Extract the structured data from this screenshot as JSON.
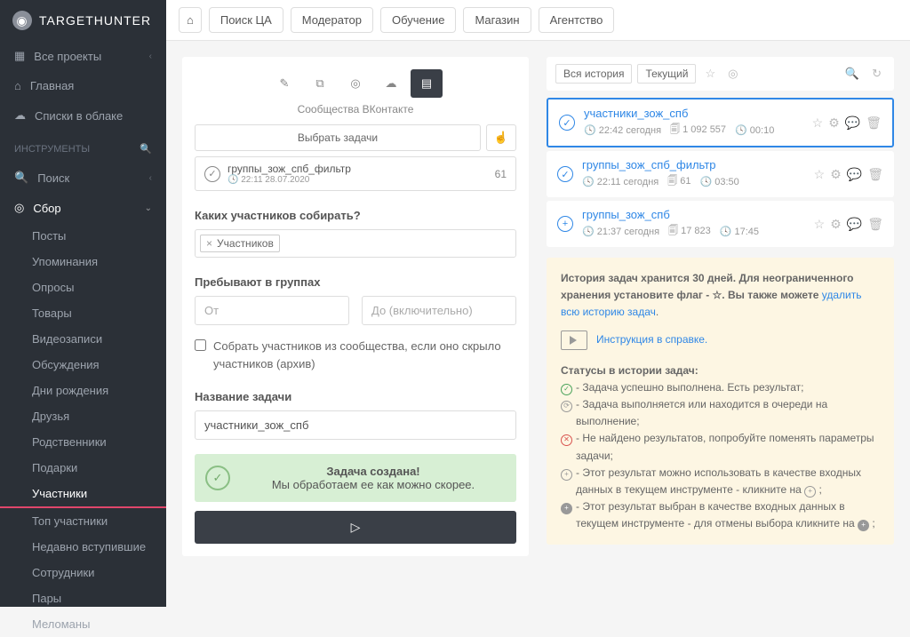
{
  "brand": {
    "name1": "TARGET",
    "name2": "HUNTER"
  },
  "sidebar": {
    "projects": "Все проекты",
    "home": "Главная",
    "cloud": "Списки в облаке",
    "tools_header": "ИНСТРУМЕНТЫ",
    "search": "Поиск",
    "gather": "Сбор",
    "subs": [
      "Посты",
      "Упоминания",
      "Опросы",
      "Товары",
      "Видеозаписи",
      "Обсуждения",
      "Дни рождения",
      "Друзья",
      "Родственники",
      "Подарки",
      "Участники",
      "Топ участники",
      "Недавно вступившие",
      "Сотрудники",
      "Пары",
      "Меломаны"
    ]
  },
  "topnav": [
    "Поиск ЦА",
    "Модератор",
    "Обучение",
    "Магазин",
    "Агентство"
  ],
  "toolTabs": {
    "caption": "Сообщества ВКонтакте"
  },
  "selectTasks": "Выбрать задачи",
  "loadedTask": {
    "title": "группы_зож_спб_фильтр",
    "meta": "22:11 28.07.2020",
    "count": "61"
  },
  "labels": {
    "which": "Каких участников собирать?",
    "chip": "Участников",
    "stay": "Пребывают в группах",
    "from": "От",
    "to": "До (включительно)",
    "hidden": "Собрать участников из сообщества, если оно скрыло участников (архив)",
    "taskName": "Название задачи"
  },
  "taskNameValue": "участники_зож_спб",
  "banner": {
    "title": "Задача создана!",
    "sub": "Мы обработаем ее как можно скорее."
  },
  "filter": {
    "all": "Вся история",
    "current": "Текущий"
  },
  "history": [
    {
      "title": "участники_зож_спб",
      "time": "22:42 сегодня",
      "count": "1 092 557",
      "dur": "00:10",
      "icon": "✓",
      "hl": true
    },
    {
      "title": "группы_зож_спб_фильтр",
      "time": "22:11 сегодня",
      "count": "61",
      "dur": "03:50",
      "icon": "✓",
      "hl": false
    },
    {
      "title": "группы_зож_спб",
      "time": "21:37 сегодня",
      "count": "17 823",
      "dur": "17:45",
      "icon": "+",
      "hl": false
    }
  ],
  "info": {
    "storage1": "История задач хранится 30 дней. Для неограниченного хранения установите флаг - ☆. Вы также можете ",
    "storageLink": "удалить всю историю задач",
    "videoLink": "Инструкция в справке.",
    "statusHdr": "Статусы в истории задач:",
    "s1": "- Задача успешно выполнена. Есть результат;",
    "s2": "- Задача выполняется или находится в очереди на выполнение;",
    "s3": "- Не найдено результатов, попробуйте поменять параметры задачи;",
    "s4a": "- Этот результат можно использовать в качестве входных данных в текущем инструменте - кликните на ",
    "s4b": " ;",
    "s5a": "- Этот результат выбран в качестве входных данных в текущем инструменте - для отмены выбора кликните на ",
    "s5b": " ;"
  }
}
